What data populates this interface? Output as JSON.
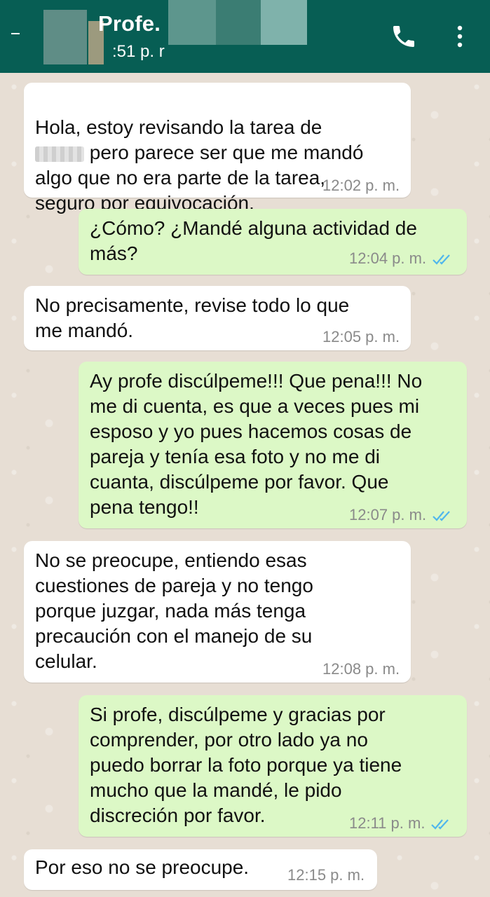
{
  "header": {
    "contact_name": "Profe.",
    "status": ":51 p. r"
  },
  "messages": [
    {
      "direction": "incoming",
      "text_line1": "Hola, estoy revisando la tarea de",
      "text_rest": "pero parece ser que me mandó\nalgo que no era parte de la tarea,\nseguro por equivocación.",
      "time": "12:02 p. m."
    },
    {
      "direction": "outgoing",
      "text": "¿Cómo? ¿Mandé alguna actividad de\nmás?",
      "time": "12:04 p. m.",
      "read": true
    },
    {
      "direction": "incoming",
      "text": "No precisamente, revise todo lo que\nme mandó.",
      "time": "12:05 p. m."
    },
    {
      "direction": "outgoing",
      "text": "Ay profe discúlpeme!!! Que pena!!! No\nme di cuenta, es que a veces pues mi\nesposo y yo pues hacemos cosas de\npareja y tenía esa foto y no me di\ncuanta, discúlpeme por favor. Que\npena tengo!!",
      "time": "12:07 p. m.",
      "read": true
    },
    {
      "direction": "incoming",
      "text": "No se preocupe, entiendo esas\ncuestiones de pareja y no tengo\nporque juzgar, nada más tenga\nprecaución con el manejo de su\ncelular.",
      "time": "12:08 p. m."
    },
    {
      "direction": "outgoing",
      "text": "Si profe, discúlpeme y gracias por\ncomprender, por otro lado ya no\npuedo borrar la foto porque ya tiene\nmucho que la mandé, le pido\ndiscreción por favor.",
      "time": "12:11 p. m.",
      "read": true
    },
    {
      "direction": "incoming",
      "text": "Por eso no se preocupe.",
      "time": "12:15 p. m."
    }
  ],
  "colors": {
    "header": "#075e54",
    "incoming_bubble": "#ffffff",
    "outgoing_bubble": "#dcf8c6",
    "read_ticks": "#4fb6ec"
  },
  "icons": [
    "back-arrow-icon",
    "phone-icon",
    "more-vert-icon",
    "double-check-icon"
  ]
}
